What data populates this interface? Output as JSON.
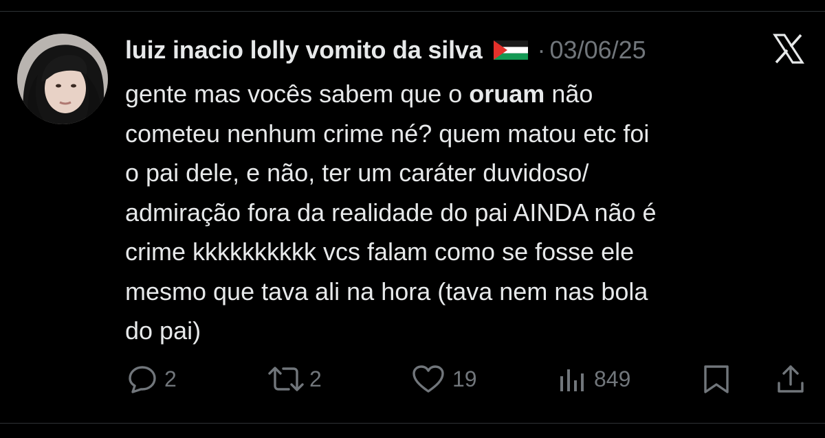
{
  "post": {
    "author": {
      "display_name": "luiz inacio lolly vomito da silva",
      "flag_icon": "palestine-flag-icon",
      "avatar_icon": "profile-photo"
    },
    "separator": "·",
    "date": "03/06/25",
    "platform_icon": "x-logo-icon",
    "body": {
      "line1_before": "gente mas vocês sabem que o ",
      "line1_mention": "oruam",
      "line1_after": " não",
      "line2": "cometeu nenhum crime né? quem matou etc foi",
      "line3": "o pai dele, e não, ter um caráter duvidoso/",
      "line4": "admiração fora da realidade do pai AINDA não é",
      "line5": "crime kkkkkkkkkk vcs falam como se fosse ele",
      "line6": "mesmo que tava ali na hora (tava nem nas bola",
      "line7": "do pai)"
    },
    "actions": {
      "reply_count": "2",
      "repost_count": "2",
      "like_count": "19",
      "views_count": "849"
    }
  },
  "colors": {
    "background": "#000000",
    "text_primary": "#e7e9ea",
    "text_secondary": "#71767b",
    "divider": "#2f3336"
  }
}
